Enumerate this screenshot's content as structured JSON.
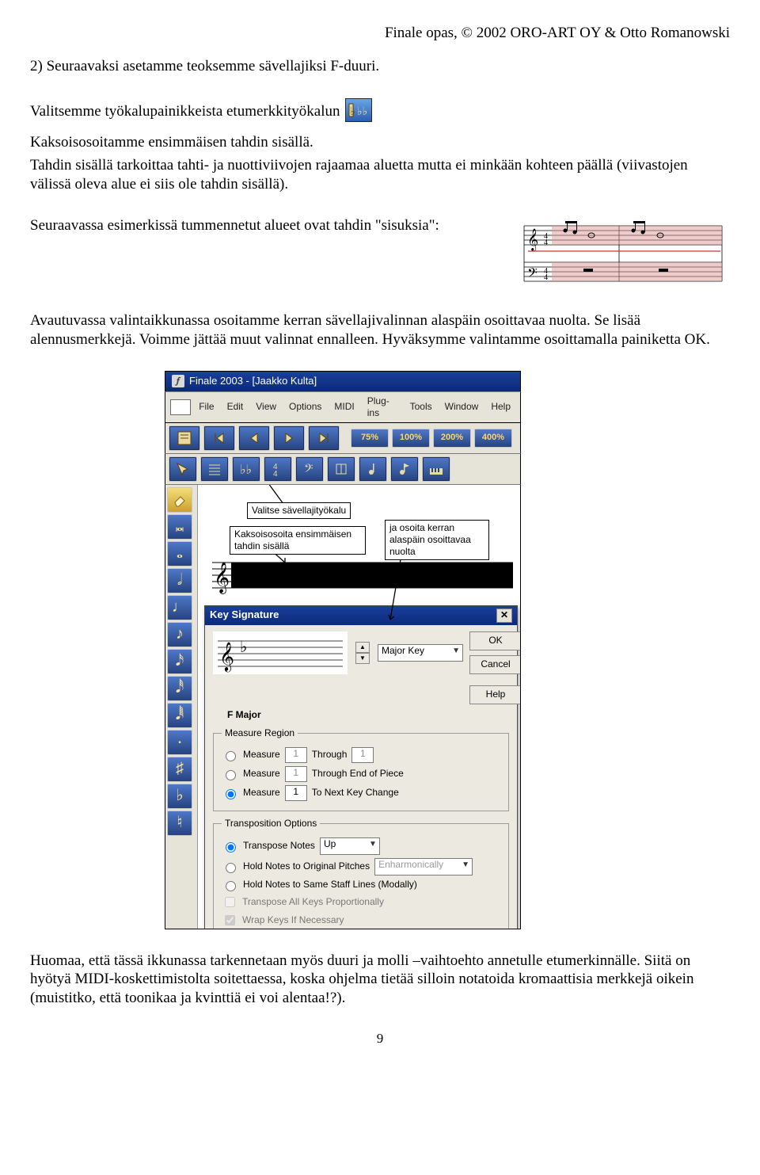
{
  "header": "Finale opas, © 2002 ORO-ART OY & Otto Romanowski",
  "p1": "2) Seuraavaksi asetamme teoksemme sävellajiksi F-duuri.",
  "p2a": "Valitsemme työkalupainikkeista etumerkkityökalun",
  "p3": "Kaksoisosoitamme ensimmäisen tahdin sisällä.",
  "p4": "Tahdin sisällä tarkoittaa tahti- ja nuottiviivojen rajaamaa aluetta mutta ei minkään kohteen päällä (viivastojen välissä oleva alue ei siis ole tahdin sisällä).",
  "p5": "Seuraavassa esimerkissä tummennetut alueet ovat tahdin \"sisuksia\":",
  "p6": "Avautuvassa valintaikkunassa osoitamme kerran sävellajivalinnan alaspäin osoittavaa nuolta. Se lisää alennusmerkkejä. Voimme jättää muut valinnat ennalleen. Hyväksymme valintamme osoittamalla painiketta OK.",
  "p7": "Huomaa, että tässä ikkunassa tarkennetaan myös duuri ja molli –vaihtoehto annetulle etumerkinnälle. Siitä on hyötyä MIDI-koskettimistolta soitettaessa, koska ohjelma tietää silloin notatoida kromaattisia merkkejä oikein (muistitko, että toonikaa ja kvinttiä ei voi alentaa!?).",
  "page_number": "9",
  "app": {
    "title": "Finale 2003 - [Jaakko Kulta]",
    "menu": [
      "File",
      "Edit",
      "View",
      "Options",
      "MIDI",
      "Plug-ins",
      "Tools",
      "Window",
      "Help"
    ],
    "zoom": [
      "75%",
      "100%",
      "200%",
      "400%"
    ],
    "callouts": {
      "c1": "Valitse sävellajityökalu",
      "c2": "Kaksoisosoita ensimmäisen tahdin sisällä",
      "c3": "ja osoita kerran alaspäin osoittavaa nuolta"
    }
  },
  "dialog": {
    "title": "Key Signature",
    "ok": "OK",
    "cancel": "Cancel",
    "help": "Help",
    "keytype": "Major Key",
    "keyname": "F Major",
    "measure_region": {
      "legend": "Measure Region",
      "opt1": "Measure",
      "through": "Through",
      "opt2": "Measure",
      "through_end": "Through End of Piece",
      "opt3": "Measure",
      "to_next": "To Next Key Change",
      "val1a": "1",
      "val1b": "1",
      "val2": "1",
      "val3": "1"
    },
    "transposition": {
      "legend": "Transposition Options",
      "opt1": "Transpose Notes",
      "up": "Up",
      "opt2": "Hold Notes to Original Pitches",
      "enh": "Enharmonically",
      "opt3": "Hold Notes to Same Staff Lines (Modally)",
      "chk1": "Transpose All Keys Proportionally",
      "chk2": "Wrap Keys If Necessary"
    }
  }
}
